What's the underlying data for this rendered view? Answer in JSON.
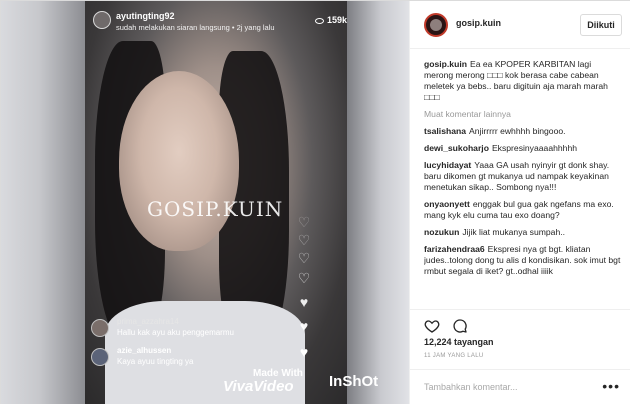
{
  "live": {
    "host_name": "ayutingting92",
    "host_subtitle": "sudah melakukan siaran langsung • 2j yang lalu",
    "viewers": "159k",
    "watermark": "GOSIP.KUIN",
    "comments": [
      {
        "user": "prima_azzahra14",
        "text": "Hallu kak ayu aku penggemarmu"
      },
      {
        "user": "azie_alhussen",
        "text": "Kaya ayuu tingting ya"
      }
    ],
    "made_with": "Made With",
    "vivavideo": "VivaVideo",
    "inshot": "InShOt"
  },
  "panel": {
    "account": "gosip.kuin",
    "follow_label": "Diikuti",
    "caption_user": "gosip.kuin",
    "caption_text": "Ea ea KPOPER KARBITAN lagi merong merong □□□ kok berasa cabe cabean meletek ya bebs.. baru digituin aja marah marah □□□",
    "load_more": "Muat komentar lainnya",
    "comments": [
      {
        "user": "tsalishana",
        "text": "Anjirrrrr ewhhhh bingooo."
      },
      {
        "user": "dewi_sukoharjo",
        "text": "Ekspresinyaaaahhhhh"
      },
      {
        "user": "lucyhidayat",
        "text": "Yaaa GA usah nyinyir gt donk shay. baru dikomen gt mukanya ud nampak keyakinan menetukan sikap.. Sombong nya!!!"
      },
      {
        "user": "onyaonyett",
        "text": "enggak bul gua gak ngefans ma exo. mang kyk elu cuma tau exo doang?"
      },
      {
        "user": "nozukun",
        "text": "Jijik liat mukanya sumpah.."
      },
      {
        "user": "farizahendraa6",
        "text": "Ekspresi nya gt bgt. kliatan judes..tolong dong tu alis d kondisikan. sok imut bgt rmbut segala di iket? gt..odhal iiiik"
      }
    ],
    "views": "12,224 tayangan",
    "time": "11 JAM YANG LALU",
    "add_comment_placeholder": "Tambahkan komentar...",
    "more": "•••"
  }
}
